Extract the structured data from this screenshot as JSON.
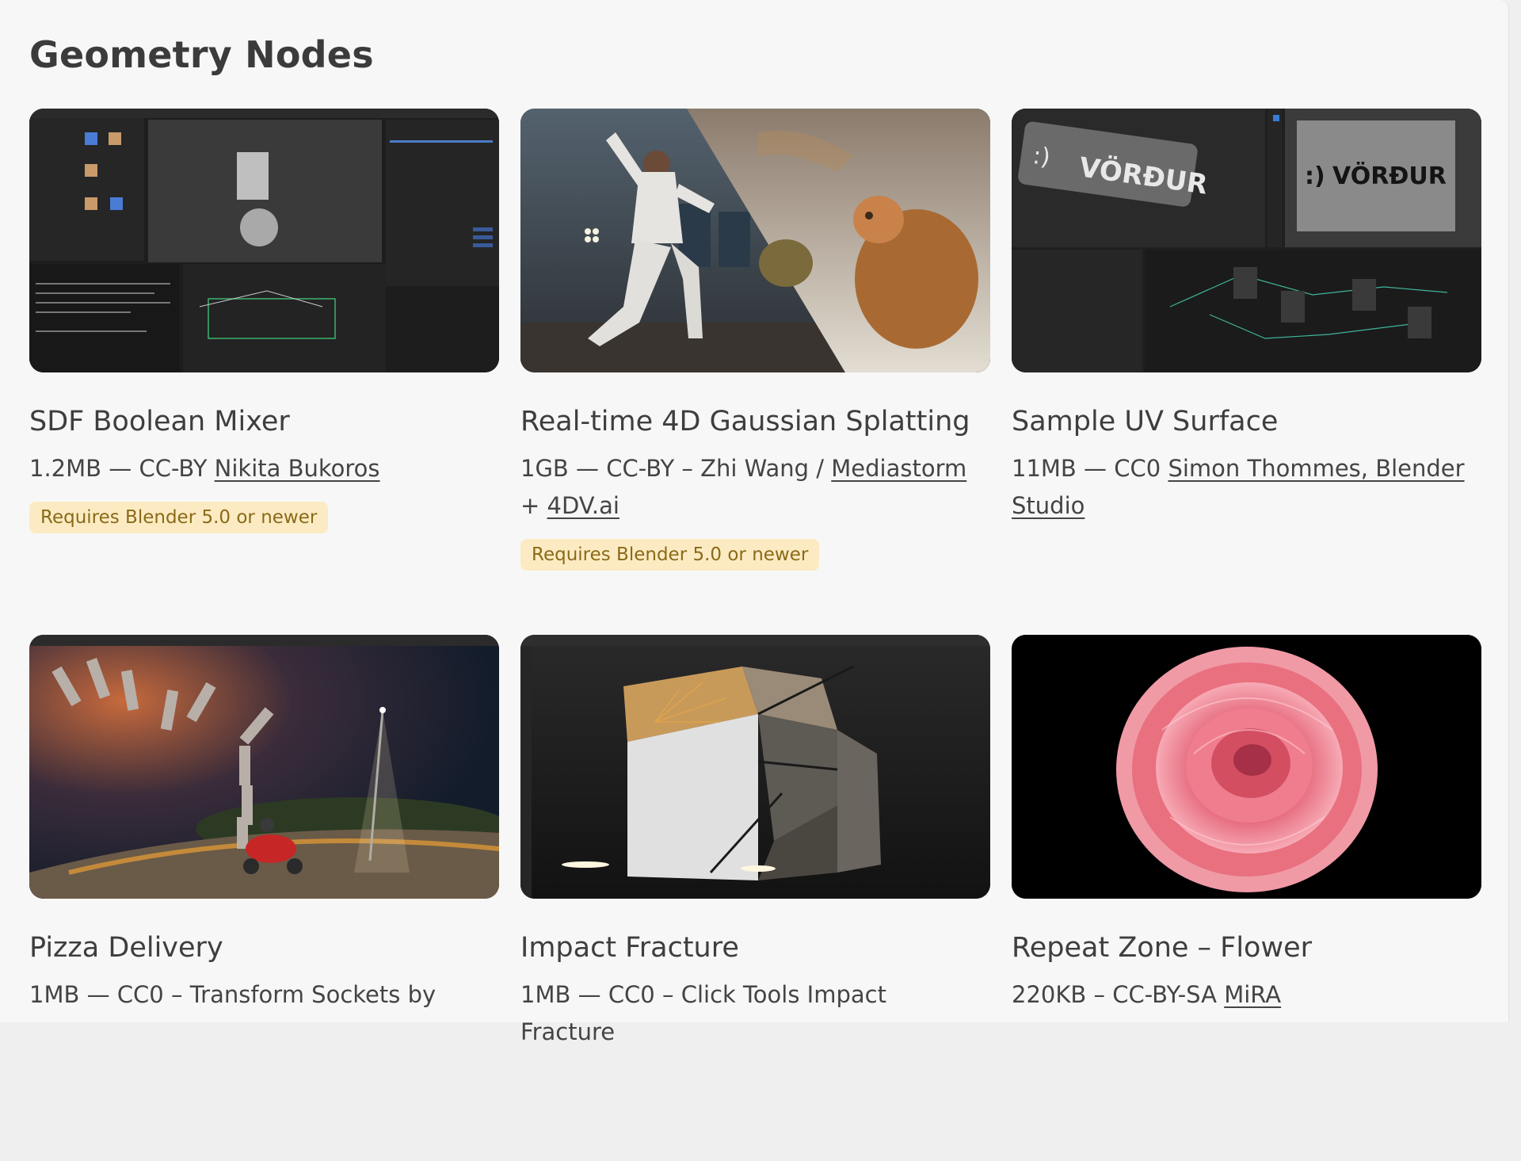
{
  "page": {
    "section_title": "Geometry Nodes"
  },
  "cards": [
    {
      "title": "SDF Boolean Mixer",
      "size": "1.2MB",
      "sep": " — ",
      "license": "CC-BY ",
      "credit_text": "",
      "link": "Nikita Bukoros",
      "suffix": "",
      "link2": "",
      "badge": "Requires Blender 5.0 or newer",
      "thumb": "blender-sdf-mixer-screenshot"
    },
    {
      "title": "Real-time 4D Gaussian Splatting",
      "size": "1GB",
      "sep": " — ",
      "license": "CC-BY",
      "credit_text": " – Zhi Wang / ",
      "link": "Mediastorm",
      "suffix": " + ",
      "link2": "4DV.ai",
      "badge": "Requires Blender 5.0 or newer",
      "thumb": "dancer-and-cat-split-image"
    },
    {
      "title": "Sample UV Surface",
      "size": "11MB",
      "sep": " — ",
      "license": "CC0 ",
      "credit_text": "",
      "link": "Simon Thommes, Blender Studio",
      "suffix": "",
      "link2": "",
      "badge": "",
      "thumb": "vordur-patch-uv-node-screenshot",
      "thumb_text": "VÖRÐUR"
    },
    {
      "title": "Pizza Delivery",
      "size": "1MB",
      "sep": " — ",
      "license": "CC0",
      "credit_text": " – Transform Sockets by",
      "link": "",
      "suffix": "",
      "link2": "",
      "badge": "",
      "thumb": "pizza-scooter-night-scene"
    },
    {
      "title": "Impact Fracture",
      "size": "1MB",
      "sep": " — ",
      "license": "CC0",
      "credit_text": " – Click Tools Impact Fracture",
      "link": "",
      "suffix": "",
      "link2": "",
      "badge": "",
      "thumb": "fractured-cube-viewport"
    },
    {
      "title": "Repeat Zone – Flower",
      "size": "220KB",
      "sep": " – ",
      "license": "CC-BY-SA ",
      "credit_text": "",
      "link": "MiRA",
      "suffix": "",
      "link2": "",
      "badge": "",
      "thumb": "pink-flower-render"
    }
  ]
}
